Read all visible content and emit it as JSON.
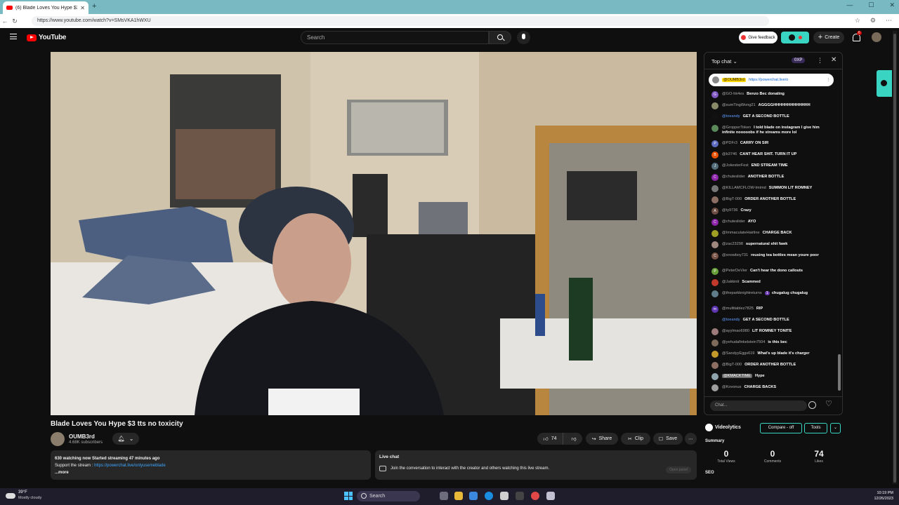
{
  "browser": {
    "tab_title": "(6) Blade Loves You Hype $3 tts n",
    "url": "https://www.youtube.com/watch?v=SMsVKA1hWXU"
  },
  "header": {
    "logo_text": "YouTube",
    "search_placeholder": "Search",
    "feedback_label": "Give feedback",
    "create_label": "Create",
    "notification_count": "6"
  },
  "video": {
    "title": "Blade Loves You Hype $3 tts no toxicity",
    "channel_name": "OUMB3rd",
    "subscribers": "4.68K subscribers",
    "likes": "74",
    "share_label": "Share",
    "clip_label": "Clip",
    "save_label": "Save"
  },
  "description": {
    "stats": "630 watching now  Started streaming 47 minutes ago",
    "support_prefix": "Support the stream : ",
    "support_link": "https://powerchat.live/onlyusemeblade",
    "more": "...more"
  },
  "live_chat_box": {
    "title": "Live chat",
    "text": "Join the conversation to interact with the creator and others watching this live stream.",
    "open_panel": "Open panel"
  },
  "chat": {
    "header_title": "Top chat",
    "xp_badge": "0XP",
    "pinned_author": "@OUMB3rd",
    "pinned_link": "https://powerchat.live/o",
    "input_placeholder": "Chat...",
    "messages": [
      {
        "author": "@GO-hk4es",
        "text": "Benzo Bec donating",
        "avatar_color": "#7e57c2",
        "initial": "G"
      },
      {
        "author": "@sumTingWong21",
        "text": "AGGGGHHHHHHHHHHHHH",
        "avatar_color": "#8a8a6a",
        "initial": ""
      },
      {
        "author": "@toeandy",
        "text": "GET A SECOND BOTTLE",
        "avatar_color": "#111111",
        "initial": "",
        "blue": true
      },
      {
        "author": "@GropperToken",
        "text": "I told blade on instagram I give him infinite nooooobs if he streams more lol",
        "avatar_color": "#5a8a5a",
        "initial": ""
      },
      {
        "author": "@PDFr3",
        "text": "CARRY ON SIR",
        "avatar_color": "#5c6bc0",
        "initial": "P"
      },
      {
        "author": "@b3746",
        "text": "CANT HEAR SHIT. TURN IT UP",
        "avatar_color": "#e65100",
        "initial": "B"
      },
      {
        "author": "@JokesterFest",
        "text": "END STREAM TIME",
        "avatar_color": "#546e7a",
        "initial": "J"
      },
      {
        "author": "@chuteslider",
        "text": "ANOTHER BOTTLE",
        "avatar_color": "#8e24aa",
        "initial": "C"
      },
      {
        "author": "@KILLAMCFLOW-lmtmd",
        "text": "SUMMON LIT ROMNEY",
        "avatar_color": "#777777",
        "initial": ""
      },
      {
        "author": "@BigT-000",
        "text": "ORDER ANOTHER BOTTLE",
        "avatar_color": "#8d6e63",
        "initial": ""
      },
      {
        "author": "@ty9736",
        "text": "Crazy",
        "avatar_color": "#6d4c41",
        "initial": "A"
      },
      {
        "author": "@chuteslider",
        "text": "AYO",
        "avatar_color": "#8e24aa",
        "initial": "C"
      },
      {
        "author": "@ImmaculateHairline",
        "text": "CHARGE BACK",
        "avatar_color": "#9e9d24",
        "initial": ""
      },
      {
        "author": "@zac23298",
        "text": "supernatural shit fawk",
        "avatar_color": "#a1887f",
        "initial": ""
      },
      {
        "author": "@snowboy731",
        "text": "reusing tea bottles mean youre poor",
        "avatar_color": "#795548",
        "initial": "C"
      },
      {
        "author": "@PeterDeVier",
        "text": "Can't hear the dono callouts",
        "avatar_color": "#689f38",
        "initial": "P"
      },
      {
        "author": "@Jakkinit",
        "text": "Scammed",
        "avatar_color": "#c0392b",
        "initial": ""
      },
      {
        "author": "@theparkknightreturns",
        "text": "chugalug chugalug",
        "avatar_color": "#607d8b",
        "initial": "",
        "member": "1"
      },
      {
        "author": "@multitablez7825",
        "text": "RIP",
        "avatar_color": "#5e35b1",
        "initial": "m"
      },
      {
        "author": "@toeandy",
        "text": "GET A SECOND BOTTLE",
        "avatar_color": "#111111",
        "initial": "",
        "blue": true
      },
      {
        "author": "@ayylmao6980",
        "text": "LIT ROMNEY TONITE",
        "avatar_color": "#9e7b7b",
        "initial": ""
      },
      {
        "author": "@yehudafinkelstein7504",
        "text": "is this bec",
        "avatar_color": "#7e6a5a",
        "initial": ""
      },
      {
        "author": "@SandyyEggs619",
        "text": "What's up blade it's charger",
        "avatar_color": "#c49a2a",
        "initial": ""
      },
      {
        "author": "@BigT-000",
        "text": "ORDER ANOTHER BOTTLE",
        "avatar_color": "#8d6e63",
        "initial": ""
      },
      {
        "author": "@KMACKTIME",
        "text": "Hype",
        "avatar_color": "#90a4ae",
        "initial": "",
        "highlight": true
      },
      {
        "author": "@Kovonus",
        "text": "CHARGE BACKS",
        "avatar_color": "#9e9e9e",
        "initial": ""
      }
    ]
  },
  "videolytics": {
    "title": "Videolytics",
    "compare_label": "Compare - off",
    "tools_label": "Tools",
    "summary_label": "Summary",
    "stats": [
      {
        "value": "0",
        "label": "Total Views"
      },
      {
        "value": "0",
        "label": "Comments"
      },
      {
        "value": "74",
        "label": "Likes"
      }
    ],
    "seo_label": "SEO"
  },
  "taskbar": {
    "weather_temp": "39°F",
    "weather_desc": "Mostly cloudy",
    "search_label": "Search",
    "time": "10:19 PM",
    "date": "12/26/2023"
  }
}
